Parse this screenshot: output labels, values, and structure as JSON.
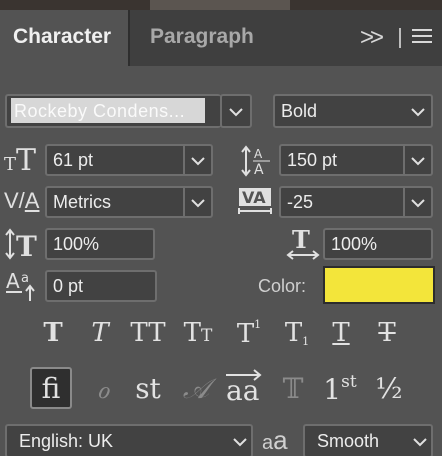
{
  "tabs": {
    "active": "Character",
    "inactive": "Paragraph"
  },
  "font": {
    "family": "Rockeby Condens...",
    "style": "Bold"
  },
  "size": "61 pt",
  "leading": "150 pt",
  "kerning": "Metrics",
  "tracking": "-25",
  "vertical_scale": "100%",
  "horizontal_scale": "100%",
  "baseline_shift": "0 pt",
  "color": {
    "label": "Color:",
    "value": "#f3e53a"
  },
  "language": "English: UK",
  "antialias": "Smooth",
  "opentype": [
    "fi",
    "st",
    "aa",
    "1st",
    "½"
  ]
}
